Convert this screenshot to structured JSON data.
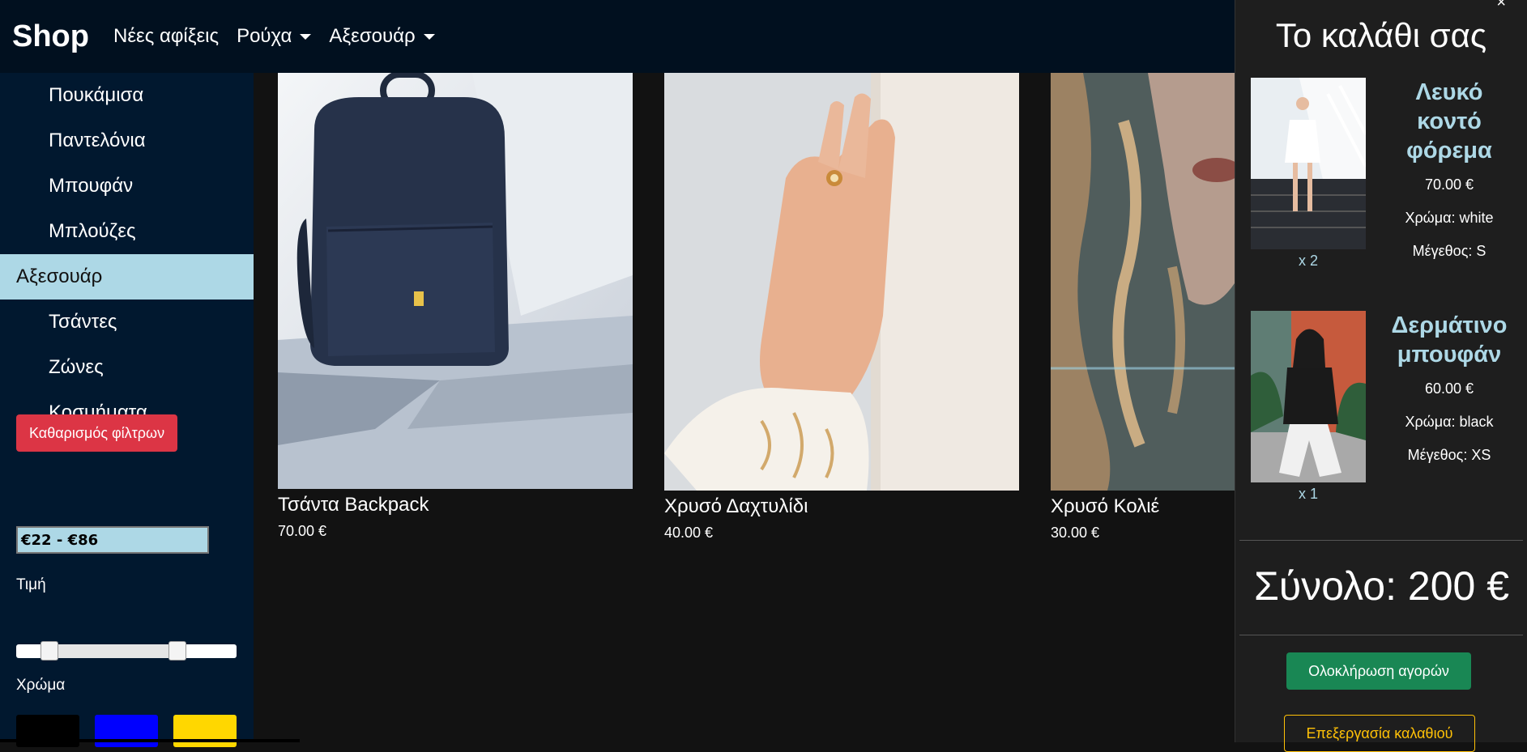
{
  "navbar": {
    "brand": "Shop",
    "links": [
      {
        "label": "Νέες αφίξεις",
        "dropdown": false
      },
      {
        "label": "Ρούχα",
        "dropdown": true
      },
      {
        "label": "Αξεσουάρ",
        "dropdown": true
      }
    ]
  },
  "sidebar": {
    "items": [
      {
        "label": "Πουκάμισα"
      },
      {
        "label": "Παντελόνια"
      },
      {
        "label": "Μπουφάν"
      },
      {
        "label": "Μπλούζες"
      },
      {
        "label": "Αξεσουάρ",
        "active": true
      },
      {
        "label": "Τσάντες"
      },
      {
        "label": "Ζώνες"
      },
      {
        "label": "Κοσμήματα"
      }
    ],
    "clear_filters_label": "Καθαρισμός φίλτρων",
    "price_label": "Τιμή",
    "price_value": "€22 - €86",
    "price_slider": {
      "min_fraction": 0.12,
      "max_fraction": 0.75
    },
    "color_label": "Χρώμα",
    "color_swatches": [
      "#000000",
      "#0000ff",
      "#ffd700"
    ]
  },
  "products": [
    {
      "name": "Τσάντα Backpack",
      "price": "70.00 €"
    },
    {
      "name": "Χρυσό Δαχτυλίδι",
      "price": "40.00 €"
    },
    {
      "name": "Χρυσό Κολιέ",
      "price": "30.00 €"
    }
  ],
  "cart": {
    "title": "Το καλάθι σας",
    "close_icon": "×",
    "items": [
      {
        "name": "Λευκό κοντό φόρεμα",
        "price": "70.00 €",
        "color": "Χρώμα: white",
        "size": "Μέγεθος: S",
        "qty": "x 2"
      },
      {
        "name": "Δερμάτινο μπουφάν",
        "price": "60.00 €",
        "color": "Χρώμα: black",
        "size": "Μέγεθος: XS",
        "qty": "x 1"
      }
    ],
    "total": "Σύνολο: 200 €",
    "checkout_label": "Ολοκλήρωση αγορών",
    "edit_label": "Επεξεργασία καλαθιού"
  },
  "colors": {
    "navbar_bg": "#01101f",
    "sidebar_bg": "#01182f",
    "active_item_bg": "#add8e6",
    "danger": "#dc3545",
    "success": "#198754",
    "warning": "#ffc107"
  }
}
